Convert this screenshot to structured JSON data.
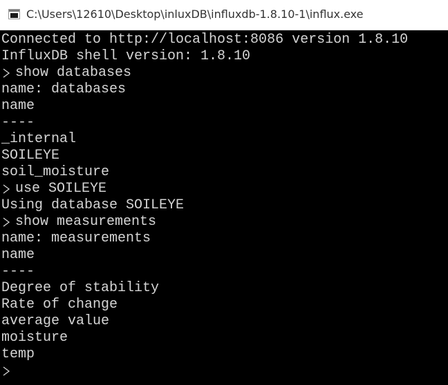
{
  "window": {
    "title": "C:\\Users\\12610\\Desktop\\inluxDB\\influxdb-1.8.10-1\\influx.exe",
    "icon": "console-app-icon"
  },
  "console": {
    "prompt_icon": "chevron-right-icon",
    "lines": [
      {
        "type": "output",
        "text": "Connected to http://localhost:8086 version 1.8.10"
      },
      {
        "type": "output",
        "text": "InfluxDB shell version: 1.8.10"
      },
      {
        "type": "command",
        "text": "show databases"
      },
      {
        "type": "output",
        "text": "name: databases"
      },
      {
        "type": "output",
        "text": "name"
      },
      {
        "type": "output",
        "text": "----"
      },
      {
        "type": "output",
        "text": "_internal"
      },
      {
        "type": "output",
        "text": "SOILEYE"
      },
      {
        "type": "output",
        "text": "soil_moisture"
      },
      {
        "type": "command",
        "text": "use SOILEYE"
      },
      {
        "type": "output",
        "text": "Using database SOILEYE"
      },
      {
        "type": "command",
        "text": "show measurements"
      },
      {
        "type": "output",
        "text": "name: measurements"
      },
      {
        "type": "output",
        "text": "name"
      },
      {
        "type": "output",
        "text": "----"
      },
      {
        "type": "output",
        "text": "Degree of stability"
      },
      {
        "type": "output",
        "text": "Rate of change"
      },
      {
        "type": "output",
        "text": "average value"
      },
      {
        "type": "output",
        "text": "moisture"
      },
      {
        "type": "output",
        "text": "temp"
      },
      {
        "type": "prompt",
        "text": ""
      }
    ]
  }
}
